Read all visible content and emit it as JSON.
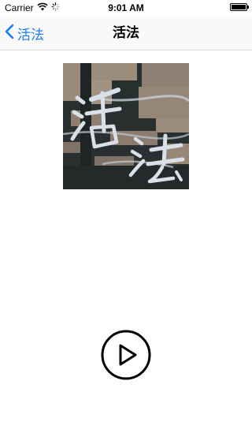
{
  "status_bar": {
    "carrier": "Carrier",
    "time": "9:01 AM",
    "battery_level": 1.0
  },
  "nav_bar": {
    "back_label": "活法",
    "title": "活法"
  },
  "album_art": {
    "calligraphy_text": "活法"
  },
  "player": {
    "state": "paused"
  }
}
